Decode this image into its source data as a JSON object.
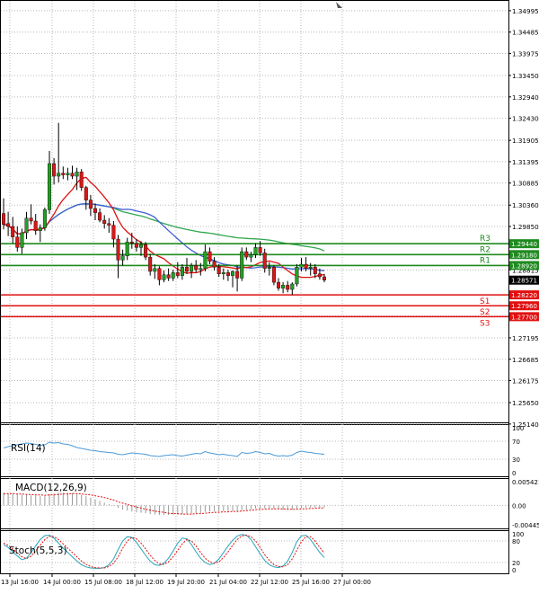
{
  "chart_data": [
    {
      "type": "candlestick",
      "title": "",
      "xlabel": "",
      "ylabel": "",
      "ylim": [
        1.2518,
        1.3525
      ],
      "grid": true,
      "x_tick_labels": [
        "13 Jul 16:00",
        "14 Jul 00:00",
        "15 Jul 08:00",
        "18 Jul 12:00",
        "19 Jul 20:00",
        "21 Jul 04:00",
        "22 Jul 12:00",
        "25 Jul 16:00",
        "27 Jul 00:00"
      ],
      "y_tick_labels": [
        "1.34995",
        "1.34485",
        "1.33975",
        "1.33450",
        "1.32940",
        "1.32430",
        "1.31905",
        "1.31395",
        "1.30885",
        "1.30360",
        "1.29850",
        "1.28815",
        "1.27720",
        "1.27195",
        "1.26685",
        "1.26175",
        "1.25650",
        "1.25140"
      ],
      "y_ticks": [
        1.34995,
        1.34485,
        1.33975,
        1.3345,
        1.3294,
        1.3243,
        1.31905,
        1.31395,
        1.30885,
        1.3036,
        1.2985,
        1.28815,
        1.2772,
        1.27195,
        1.26685,
        1.26175,
        1.2565,
        1.2514
      ],
      "current_price": "1.28571",
      "current_price_value": 1.28571,
      "levels": [
        {
          "name": "R3",
          "label": "1.29440",
          "value": 1.2944,
          "color": "#1f8a1f"
        },
        {
          "name": "R2",
          "label": "1.29180",
          "value": 1.2918,
          "color": "#1f8a1f"
        },
        {
          "name": "R1",
          "label": "1.28920",
          "value": 1.2892,
          "color": "#1f8a1f"
        },
        {
          "name": "S1",
          "label": "1.28220",
          "value": 1.2822,
          "color": "#e01010"
        },
        {
          "name": "S2",
          "label": "1.27960",
          "value": 1.2796,
          "color": "#e01010"
        },
        {
          "name": "S3",
          "label": "1.27700",
          "value": 1.277,
          "color": "#e01010"
        }
      ],
      "candles": [
        [
          1.3016,
          1.3052,
          1.2978,
          1.299
        ],
        [
          1.2992,
          1.302,
          1.2962,
          1.2985
        ],
        [
          1.2985,
          1.3008,
          1.2945,
          1.296
        ],
        [
          1.296,
          1.2985,
          1.2925,
          1.2935
        ],
        [
          1.2935,
          1.298,
          1.292,
          1.297
        ],
        [
          1.297,
          1.302,
          1.2955,
          1.3005
        ],
        [
          1.3005,
          1.3038,
          1.299,
          1.2998
        ],
        [
          1.2998,
          1.3015,
          1.2965,
          1.2975
        ],
        [
          1.2975,
          1.299,
          1.2948,
          1.2982
        ],
        [
          1.2982,
          1.303,
          1.2975,
          1.3025
        ],
        [
          1.3025,
          1.3165,
          1.3015,
          1.3135
        ],
        [
          1.3135,
          1.3148,
          1.3085,
          1.3105
        ],
        [
          1.3105,
          1.3232,
          1.309,
          1.3112
        ],
        [
          1.3112,
          1.3128,
          1.3098,
          1.3108
        ],
        [
          1.3108,
          1.3125,
          1.3095,
          1.3112
        ],
        [
          1.3112,
          1.313,
          1.3098,
          1.3105
        ],
        [
          1.3105,
          1.3125,
          1.3072,
          1.3115
        ],
        [
          1.3115,
          1.3122,
          1.307,
          1.3078
        ],
        [
          1.3078,
          1.3082,
          1.3025,
          1.3048
        ],
        [
          1.3048,
          1.306,
          1.301,
          1.3028
        ],
        [
          1.3028,
          1.304,
          1.3,
          1.3018
        ],
        [
          1.3018,
          1.3028,
          1.2995,
          1.3
        ],
        [
          1.3,
          1.3012,
          1.298,
          1.2992
        ],
        [
          1.2992,
          1.3005,
          1.297,
          1.2988
        ],
        [
          1.2988,
          1.2998,
          1.2935,
          1.2955
        ],
        [
          1.2955,
          1.2965,
          1.2862,
          1.2905
        ],
        [
          1.2905,
          1.293,
          1.2892,
          1.2915
        ],
        [
          1.2915,
          1.2958,
          1.2905,
          1.2948
        ],
        [
          1.2948,
          1.297,
          1.2932,
          1.2945
        ],
        [
          1.2945,
          1.2955,
          1.2925,
          1.2935
        ],
        [
          1.2935,
          1.295,
          1.2915,
          1.2942
        ],
        [
          1.2942,
          1.2948,
          1.2905,
          1.2912
        ],
        [
          1.2912,
          1.292,
          1.2868,
          1.2878
        ],
        [
          1.2878,
          1.2895,
          1.286,
          1.2885
        ],
        [
          1.2885,
          1.289,
          1.2845,
          1.2858
        ],
        [
          1.2858,
          1.288,
          1.2852,
          1.287
        ],
        [
          1.287,
          1.2885,
          1.2855,
          1.2862
        ],
        [
          1.2862,
          1.2882,
          1.2855,
          1.2875
        ],
        [
          1.2875,
          1.29,
          1.2862,
          1.2868
        ],
        [
          1.2868,
          1.2895,
          1.2858,
          1.2888
        ],
        [
          1.2888,
          1.291,
          1.2872,
          1.2878
        ],
        [
          1.2878,
          1.2898,
          1.2862,
          1.2892
        ],
        [
          1.2892,
          1.2905,
          1.2875,
          1.2882
        ],
        [
          1.2882,
          1.2898,
          1.2868,
          1.2885
        ],
        [
          1.2885,
          1.2942,
          1.2878,
          1.2925
        ],
        [
          1.2925,
          1.2935,
          1.2895,
          1.2902
        ],
        [
          1.2902,
          1.2912,
          1.288,
          1.2888
        ],
        [
          1.2888,
          1.2895,
          1.2865,
          1.2872
        ],
        [
          1.2872,
          1.2885,
          1.2858,
          1.2875
        ],
        [
          1.2875,
          1.2882,
          1.2855,
          1.2868
        ],
        [
          1.2868,
          1.288,
          1.284,
          1.2878
        ],
        [
          1.2878,
          1.2892,
          1.283,
          1.2862
        ],
        [
          1.2862,
          1.2935,
          1.2855,
          1.2925
        ],
        [
          1.2925,
          1.2935,
          1.2905,
          1.2912
        ],
        [
          1.2912,
          1.2925,
          1.29,
          1.2918
        ],
        [
          1.2918,
          1.2945,
          1.291,
          1.2935
        ],
        [
          1.2935,
          1.295,
          1.2915,
          1.2922
        ],
        [
          1.2922,
          1.2932,
          1.2875,
          1.2885
        ],
        [
          1.2885,
          1.29,
          1.2868,
          1.2888
        ],
        [
          1.2888,
          1.2892,
          1.2845,
          1.2852
        ],
        [
          1.2852,
          1.2862,
          1.2832,
          1.2838
        ],
        [
          1.2838,
          1.2852,
          1.2826,
          1.2845
        ],
        [
          1.2845,
          1.2855,
          1.2828,
          1.2835
        ],
        [
          1.2835,
          1.2852,
          1.2822,
          1.2848
        ],
        [
          1.2848,
          1.2895,
          1.2842,
          1.2888
        ],
        [
          1.2888,
          1.291,
          1.2878,
          1.2895
        ],
        [
          1.2895,
          1.2912,
          1.2878,
          1.2885
        ],
        [
          1.2885,
          1.2898,
          1.2868,
          1.2888
        ],
        [
          1.2888,
          1.2895,
          1.2862,
          1.2872
        ],
        [
          1.2872,
          1.2885,
          1.2858,
          1.2865
        ],
        [
          1.2865,
          1.2872,
          1.2852,
          1.2857
        ]
      ],
      "indicators": [
        "moving average (red)",
        "moving average (blue)",
        "moving average (green)"
      ]
    },
    {
      "type": "line",
      "title": "RSI(14)",
      "ylim": [
        0,
        100
      ],
      "y_tick_labels": [
        "100",
        "70",
        "30",
        "0"
      ],
      "series": [
        {
          "name": "RSI(14)",
          "color": "#4a9ad8",
          "values": [
            55,
            58,
            60,
            62,
            64,
            66,
            65,
            63,
            61,
            62,
            68,
            66,
            67,
            64,
            63,
            60,
            56,
            54,
            52,
            50,
            49,
            47,
            46,
            45,
            44,
            41,
            40,
            42,
            44,
            43,
            42,
            41,
            38,
            37,
            36,
            38,
            39,
            40,
            38,
            37,
            39,
            41,
            43,
            42,
            47,
            44,
            42,
            40,
            41,
            39,
            38,
            36,
            45,
            43,
            44,
            47,
            45,
            42,
            43,
            39,
            37,
            38,
            37,
            39,
            45,
            48,
            46,
            45,
            43,
            42,
            41
          ]
        }
      ]
    },
    {
      "type": "bar",
      "title": "MACD(12,26,9)",
      "y_tick_labels": [
        "0.005421",
        "0.00",
        "-0.004458"
      ],
      "ylim": [
        -0.004458,
        0.005421
      ],
      "series": [
        {
          "name": "MACD(12,26,9)",
          "color": "#a0a0a0",
          "values": [
            0.0029,
            0.0028,
            0.0027,
            0.0025,
            0.0024,
            0.0024,
            0.0023,
            0.0022,
            0.0021,
            0.0021,
            0.0026,
            0.0027,
            0.0029,
            0.0029,
            0.0029,
            0.0028,
            0.0026,
            0.0024,
            0.0021,
            0.0018,
            0.0014,
            0.001,
            0.0006,
            0.0003,
            -0.0001,
            -0.0006,
            -0.001,
            -0.0012,
            -0.0014,
            -0.0016,
            -0.0017,
            -0.0018,
            -0.002,
            -0.0021,
            -0.0022,
            -0.0022,
            -0.0022,
            -0.0021,
            -0.0021,
            -0.002,
            -0.002,
            -0.0019,
            -0.0018,
            -0.0018,
            -0.0015,
            -0.0014,
            -0.0014,
            -0.0014,
            -0.0013,
            -0.0013,
            -0.0013,
            -0.0014,
            -0.0011,
            -0.001,
            -0.0009,
            -0.0007,
            -0.0007,
            -0.0007,
            -0.0007,
            -0.0008,
            -0.0009,
            -0.001,
            -0.001,
            -0.001,
            -0.0008,
            -0.0006,
            -0.0005,
            -0.0005,
            -0.0005,
            -0.0005,
            -0.0005
          ]
        },
        {
          "name": "Signal",
          "color": "#e01010",
          "values": [
            0.0026,
            0.0027,
            0.0027,
            0.0026,
            0.0026,
            0.0025,
            0.0025,
            0.0024,
            0.0024,
            0.0023,
            0.0024,
            0.0024,
            0.0025,
            0.0026,
            0.0026,
            0.0027,
            0.0027,
            0.0026,
            0.0025,
            0.0024,
            0.0022,
            0.002,
            0.0018,
            0.0015,
            0.0012,
            0.0008,
            0.0005,
            0.0002,
            -0.0001,
            -0.0004,
            -0.0006,
            -0.0009,
            -0.0011,
            -0.0013,
            -0.0015,
            -0.0016,
            -0.0018,
            -0.0019,
            -0.0019,
            -0.002,
            -0.002,
            -0.002,
            -0.0019,
            -0.0019,
            -0.0018,
            -0.0017,
            -0.0016,
            -0.0016,
            -0.0015,
            -0.0015,
            -0.0014,
            -0.0014,
            -0.0013,
            -0.0012,
            -0.0011,
            -0.001,
            -0.0009,
            -0.0009,
            -0.0008,
            -0.0008,
            -0.0008,
            -0.0008,
            -0.0009,
            -0.0009,
            -0.0009,
            -0.0008,
            -0.0008,
            -0.0007,
            -0.0007,
            -0.0006,
            -0.0006
          ]
        }
      ]
    },
    {
      "type": "line",
      "title": "Stoch(5,5,3)",
      "ylim": [
        0,
        100
      ],
      "y_tick_labels": [
        "100",
        "80",
        "20",
        "0"
      ],
      "series": [
        {
          "name": "%K",
          "color": "#26a4b8",
          "values": [
            70,
            62,
            50,
            38,
            28,
            32,
            48,
            66,
            84,
            95,
            96,
            88,
            74,
            60,
            48,
            36,
            24,
            14,
            8,
            5,
            4,
            4,
            6,
            14,
            30,
            56,
            80,
            92,
            90,
            76,
            58,
            40,
            24,
            14,
            12,
            18,
            32,
            52,
            74,
            88,
            86,
            70,
            50,
            32,
            20,
            14,
            18,
            30,
            48,
            66,
            82,
            94,
            98,
            96,
            84,
            64,
            44,
            26,
            14,
            8,
            6,
            10,
            24,
            48,
            78,
            94,
            96,
            84,
            66,
            48,
            34
          ]
        },
        {
          "name": "%D",
          "color": "#e01010",
          "values": [
            74,
            68,
            58,
            46,
            36,
            31,
            38,
            52,
            68,
            84,
            93,
            92,
            84,
            72,
            60,
            48,
            36,
            24,
            15,
            9,
            6,
            5,
            5,
            9,
            18,
            36,
            60,
            80,
            90,
            86,
            74,
            58,
            40,
            26,
            16,
            15,
            22,
            36,
            54,
            72,
            84,
            80,
            66,
            48,
            32,
            22,
            18,
            22,
            34,
            50,
            68,
            84,
            94,
            96,
            92,
            80,
            62,
            42,
            26,
            14,
            9,
            8,
            14,
            30,
            54,
            78,
            92,
            92,
            80,
            62,
            46
          ]
        }
      ]
    }
  ]
}
